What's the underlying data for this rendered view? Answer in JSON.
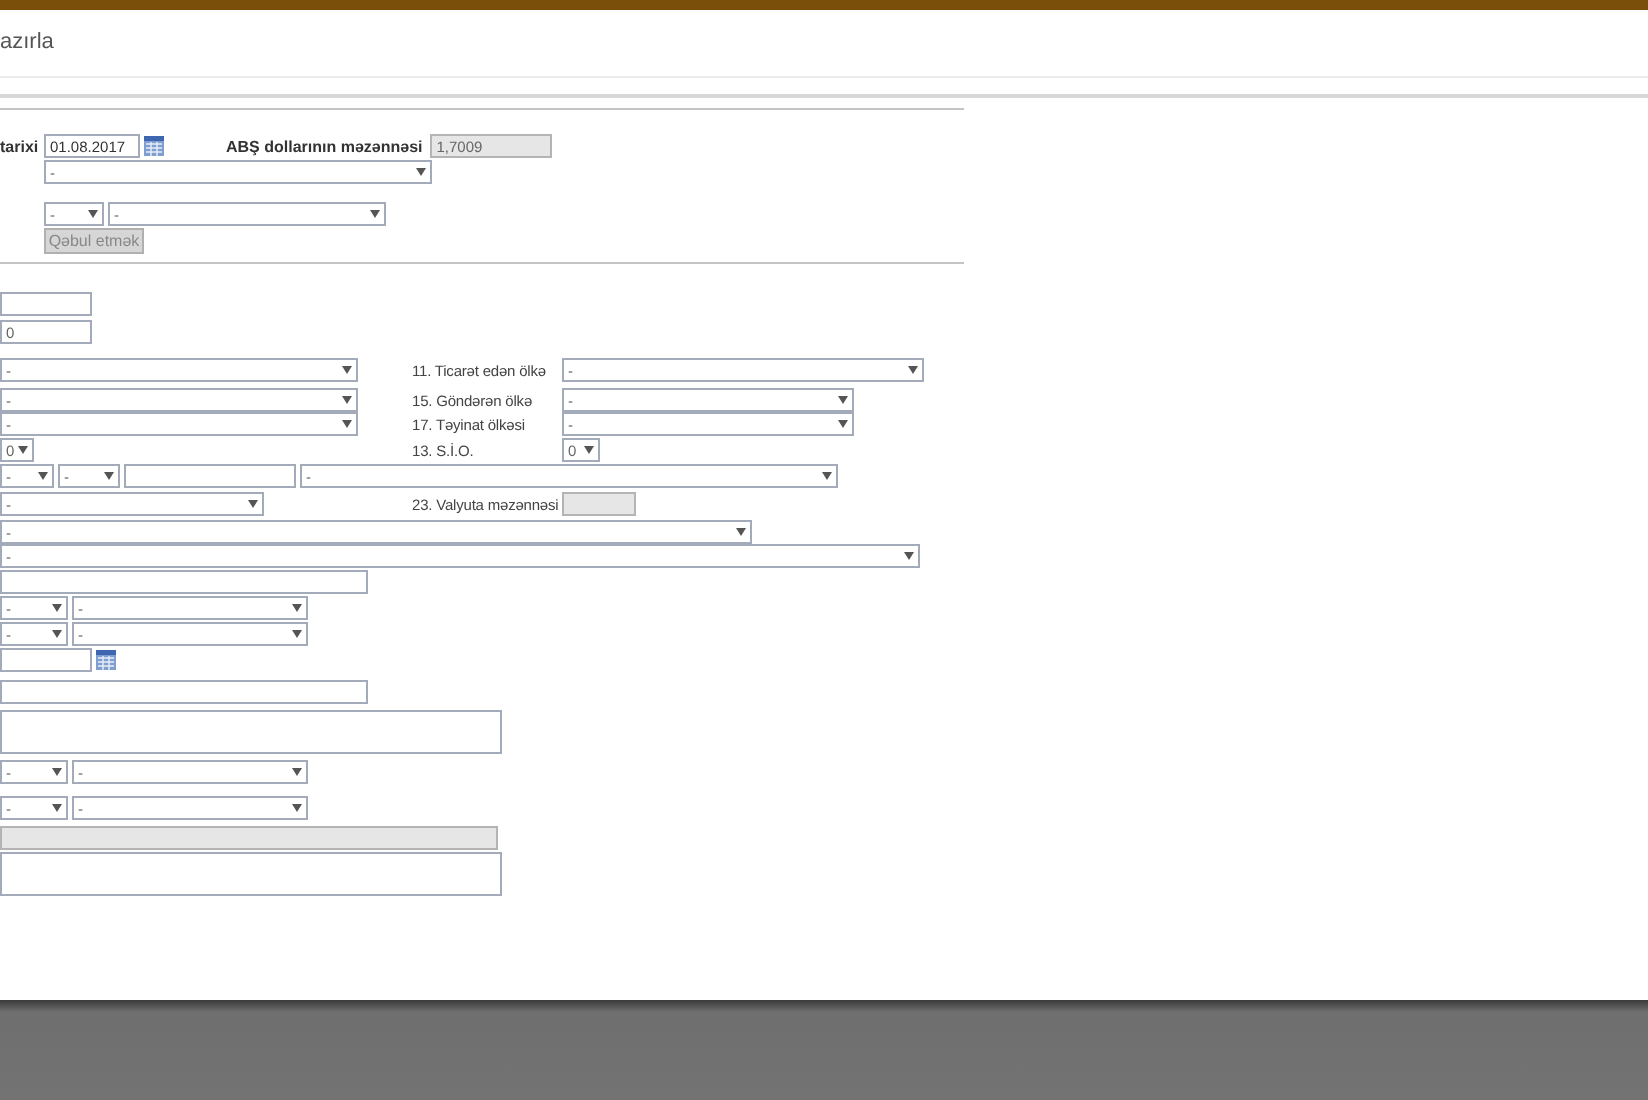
{
  "header": {
    "title": "azırla"
  },
  "top": {
    "date_label": "tarixi",
    "date": "01.08.2017",
    "rate_label": "ABŞ dollarının məzənnəsi",
    "rate": "1,7009",
    "select_1": "-",
    "select_2a": "-",
    "select_2b": "-",
    "button": {
      "label": "Qəbul etmək",
      "disabled": true
    }
  },
  "rows": [
    {
      "fields": [
        {
          "kind": "input"
        }
      ]
    },
    {
      "fields": [
        {
          "kind": "input",
          "value": "0"
        }
      ]
    },
    {
      "fields": [
        {
          "kind": "select",
          "value": "-"
        }
      ],
      "right": {
        "label": "11. Ticarət edən ölkə",
        "fields": [
          {
            "kind": "select",
            "value": "-"
          }
        ]
      }
    },
    {
      "fields": [
        {
          "kind": "select",
          "value": "-"
        }
      ],
      "right": {
        "label": "15. Göndərən ölkə",
        "fields": [
          {
            "kind": "select",
            "value": "-"
          }
        ]
      }
    },
    {
      "fields": [
        {
          "kind": "select",
          "value": "-"
        }
      ],
      "right": {
        "label": "17. Təyinat ölkəsi",
        "fields": [
          {
            "kind": "select",
            "value": "-"
          }
        ]
      }
    },
    {
      "fields": [
        {
          "kind": "select",
          "value": "0"
        }
      ],
      "right": {
        "label": "13. S.İ.O.",
        "fields": [
          {
            "kind": "select",
            "value": "0"
          }
        ]
      }
    },
    {
      "fields": [
        {
          "kind": "select",
          "value": "-"
        },
        {
          "kind": "select",
          "value": "-"
        },
        {
          "kind": "input"
        },
        {
          "kind": "select",
          "value": "-"
        }
      ]
    },
    {
      "fields": [
        {
          "kind": "select",
          "value": "-"
        }
      ],
      "right": {
        "label": "23. Valyuta məzənnəsi",
        "fields": [
          {
            "kind": "readonly"
          }
        ]
      }
    },
    {
      "fields": [
        {
          "kind": "select",
          "value": "-"
        }
      ]
    },
    {
      "fields": [
        {
          "kind": "select",
          "value": "-"
        }
      ]
    },
    {
      "fields": [
        {
          "kind": "input"
        }
      ]
    },
    {
      "fields": [
        {
          "kind": "select",
          "value": "-"
        },
        {
          "kind": "select",
          "value": "-"
        }
      ]
    },
    {
      "fields": [
        {
          "kind": "select",
          "value": "-"
        },
        {
          "kind": "select",
          "value": "-"
        }
      ]
    },
    {
      "fields": [
        {
          "kind": "input"
        },
        {
          "kind": "calendar"
        }
      ]
    },
    {
      "fields": [
        {
          "kind": "input"
        }
      ]
    },
    {
      "fields": [
        {
          "kind": "textarea"
        }
      ]
    },
    {
      "fields": [
        {
          "kind": "select",
          "value": "-"
        },
        {
          "kind": "select",
          "value": "-"
        }
      ]
    },
    {
      "fields": [
        {
          "kind": "select",
          "value": "-"
        },
        {
          "kind": "select",
          "value": "-"
        }
      ]
    },
    {
      "fields": [
        {
          "kind": "readonly"
        }
      ]
    },
    {
      "fields": [
        {
          "kind": "textarea"
        }
      ]
    }
  ]
}
